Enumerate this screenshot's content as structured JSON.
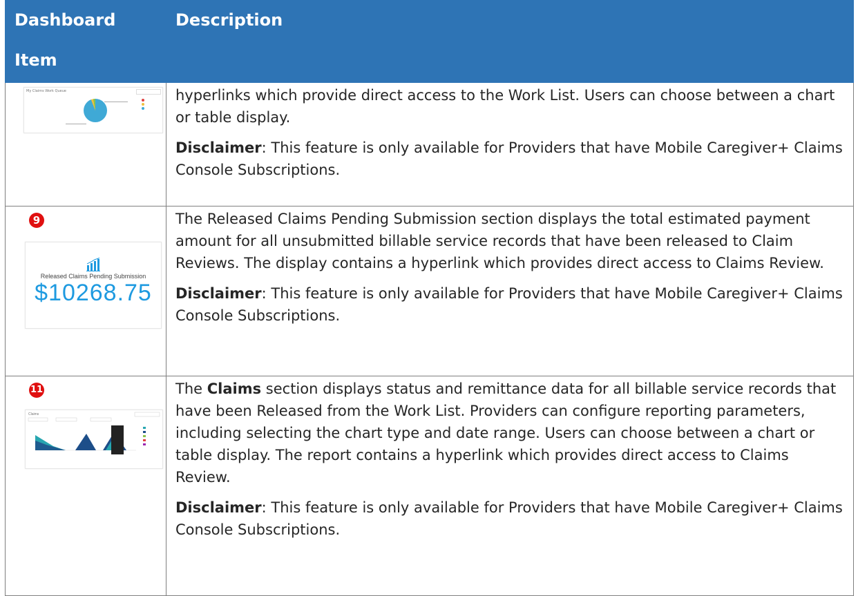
{
  "header": {
    "col1": "Dashboard Item",
    "col1_line1": "Dashboard",
    "col1_line2": "Item",
    "col2": "Description"
  },
  "rows": [
    {
      "thumbnail": {
        "title": "My Claims Work Queue"
      },
      "paragraph": "hyperlinks which provide direct access to the Work List. Users can choose between a chart or table display.",
      "disclaimer_label": "Disclaimer",
      "disclaimer_text": ": This feature is only available for Providers that have Mobile Caregiver+ Claims Console Subscriptions."
    },
    {
      "badge": "9",
      "thumbnail": {
        "label": "Released Claims Pending Submission",
        "amount": "$10268.75"
      },
      "paragraph": "The Released Claims Pending Submission section displays the total estimated payment amount for all unsubmitted billable service records that have been released to Claim Reviews. The display contains a hyperlink which provides direct access to Claims Review.",
      "disclaimer_label": "Disclaimer",
      "disclaimer_text": ": This feature is only available for Providers that have Mobile Caregiver+ Claims Console Subscriptions."
    },
    {
      "badge": "11",
      "thumbnail": {
        "title": "Claims"
      },
      "para_prefix": "The ",
      "para_bold": "Claims",
      "para_rest": " section displays status and remittance data for all billable service records that have been Released from the Work List. Providers can configure reporting parameters, including selecting the chart type and date range. Users can choose between a chart or table display. The report contains a hyperlink which provides direct access to Claims Review.",
      "disclaimer_label": "Disclaimer",
      "disclaimer_text": ": This feature is only available for Providers that have Mobile Caregiver+ Claims Console Subscriptions."
    }
  ],
  "colors": {
    "header_bg": "#2e74b5",
    "badge": "#e01010",
    "amount": "#1e9ae0"
  }
}
